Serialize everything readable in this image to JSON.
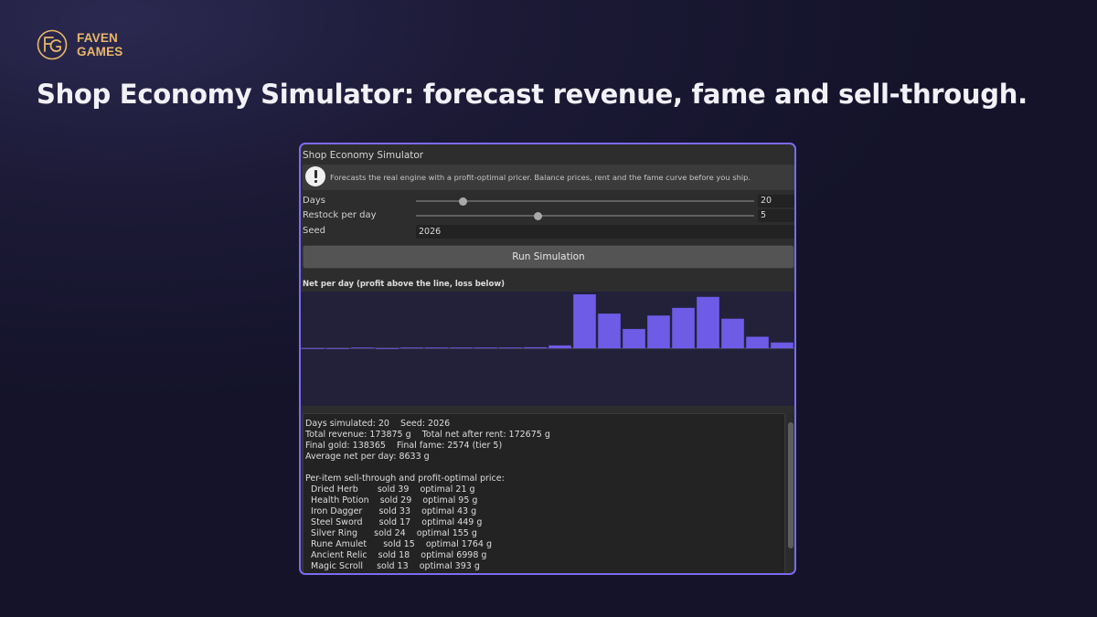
{
  "brand": {
    "line1": "FAVEN",
    "line2": "GAMES",
    "logo_icon": "fg-monogram-icon",
    "accent": "#e8b86a"
  },
  "headline": "Shop Economy Simulator: forecast revenue, fame and sell-through.",
  "window": {
    "title": "Shop Economy Simulator",
    "border_color": "#7c6bf0",
    "help": {
      "icon": "exclamation-icon",
      "text": "Forecasts the real engine with a profit-optimal pricer. Balance prices, rent and the fame curve before you ship."
    },
    "fields": {
      "days": {
        "label": "Days",
        "value": "20",
        "slider_fraction": 0.14
      },
      "restock": {
        "label": "Restock per day",
        "value": "5",
        "slider_fraction": 0.36
      },
      "seed": {
        "label": "Seed",
        "value": "2026"
      }
    },
    "run_button": "Run Simulation",
    "chart_title": "Net per day (profit above the line, loss below)",
    "report_lines": [
      "Days simulated: 20    Seed: 2026",
      "Total revenue: 173875 g    Total net after rent: 172675 g",
      "Final gold: 138365    Final fame: 2574 (tier 5)",
      "Average net per day: 8633 g",
      "",
      "Per-item sell-through and profit-optimal price:",
      "  Dried Herb       sold 39    optimal 21 g",
      "  Health Potion    sold 29    optimal 95 g",
      "  Iron Dagger      sold 33    optimal 43 g",
      "  Steel Sword      sold 17    optimal 449 g",
      "  Silver Ring      sold 24    optimal 155 g",
      "  Rune Amulet      sold 15    optimal 1764 g",
      "  Ancient Relic    sold 18    optimal 6998 g",
      "  Magic Scroll     sold 13    optimal 393 g"
    ]
  },
  "chart_data": {
    "type": "bar",
    "title": "Net per day (profit above the line, loss below)",
    "xlabel": "",
    "ylabel": "",
    "x": [
      1,
      2,
      3,
      4,
      5,
      6,
      7,
      8,
      9,
      10,
      11,
      12,
      13,
      14,
      15,
      16,
      17,
      18,
      19,
      20
    ],
    "values": [
      -30,
      -30,
      110,
      -20,
      80,
      180,
      130,
      250,
      330,
      800,
      2200,
      42000,
      27000,
      15000,
      25500,
      31500,
      40000,
      23000,
      9000,
      4500
    ],
    "ylim": [
      -42000,
      42000
    ],
    "bar_color": "#6e5be6",
    "baseline_color": "#5a5775",
    "grid": false,
    "legend": false
  }
}
